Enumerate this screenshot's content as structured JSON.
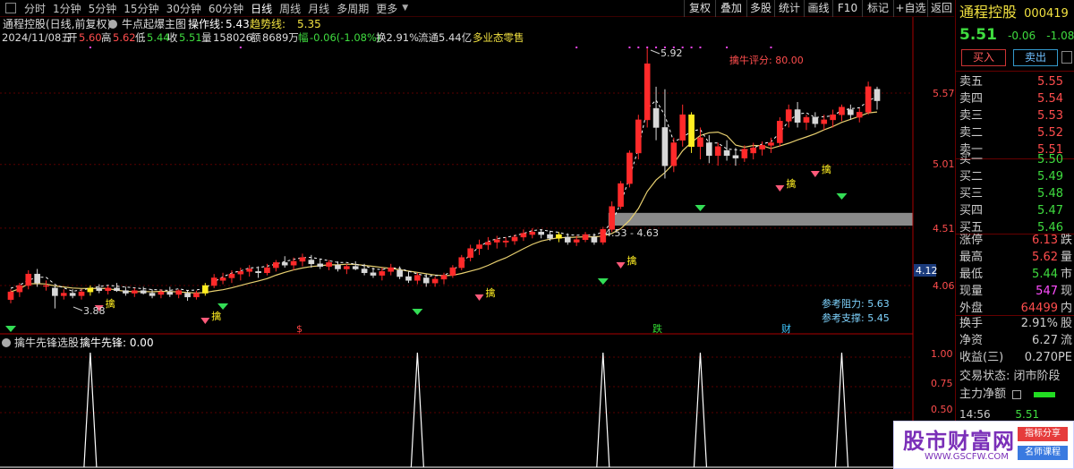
{
  "toolbar": {
    "periods": [
      "分时",
      "1分钟",
      "5分钟",
      "15分钟",
      "30分钟",
      "60分钟",
      "日线",
      "周线",
      "月线",
      "多周期",
      "更多"
    ],
    "active": "日线",
    "tools": [
      "复权",
      "叠加",
      "多股",
      "统计",
      "画线",
      "F10",
      "标记",
      "+自选",
      "返回"
    ]
  },
  "header": {
    "line1": {
      "title": "通程控股(日线,前复权)",
      "ind_name": "牛点起爆主图",
      "op_label": "操作线:",
      "op_value": "5.43",
      "trend_label": "趋势线:",
      "trend_value": "5.35"
    },
    "line2": {
      "date": "2024/11/08五",
      "open_l": "开",
      "open_v": "5.60",
      "high_l": "高",
      "high_v": "5.62",
      "low_l": "低",
      "low_v": "5.44",
      "close_l": "收",
      "close_v": "5.51",
      "vol_l": "量",
      "vol_v": "158026",
      "amt_l": "额",
      "amt_v": "8689万",
      "chg_l": "幅",
      "chg_v": "-0.06(-1.08%)",
      "turn": "换2.91%",
      "float": "流通5.44亿",
      "status": "多业态零售"
    }
  },
  "annotations": {
    "peak": "5.92",
    "low": "3.88",
    "rating": "擒牛评分: 80.00",
    "range": "4.53 - 4.63",
    "resist": "参考阻力: 5.63",
    "support": "参考支撑: 5.45",
    "marks": [
      {
        "t": "$",
        "c": "#ff4444"
      },
      {
        "t": "跌",
        "c": "#33dd33"
      },
      {
        "t": "财",
        "c": "#3fc7ff"
      }
    ],
    "signal_char": "擒"
  },
  "axis": {
    "price_ticks": [
      "5.57",
      "5.01",
      "4.51",
      "4.06"
    ],
    "current_price": "4.12",
    "ind_ticks": [
      "1.00",
      "0.75",
      "0.50"
    ]
  },
  "indicator": {
    "name": "擒牛先锋选股",
    "label": "擒牛先锋: 0.00"
  },
  "quote": {
    "name": "通程控股",
    "code": "000419",
    "price": "5.51",
    "change": "-0.06",
    "pct": "-1.08%",
    "buy": "买入",
    "sell": "卖出",
    "asks": [
      {
        "l": "卖五",
        "p": "5.55"
      },
      {
        "l": "卖四",
        "p": "5.54"
      },
      {
        "l": "卖三",
        "p": "5.53"
      },
      {
        "l": "卖二",
        "p": "5.52"
      },
      {
        "l": "卖一",
        "p": "5.51"
      }
    ],
    "bids": [
      {
        "l": "买一",
        "p": "5.50"
      },
      {
        "l": "买二",
        "p": "5.49"
      },
      {
        "l": "买三",
        "p": "5.48"
      },
      {
        "l": "买四",
        "p": "5.47"
      },
      {
        "l": "买五",
        "p": "5.46"
      }
    ],
    "stats": [
      {
        "l": "涨停",
        "v": "6.13",
        "s": "跌",
        "c": "red"
      },
      {
        "l": "最高",
        "v": "5.62",
        "s": "量",
        "c": "red"
      },
      {
        "l": "最低",
        "v": "5.44",
        "s": "市",
        "c": "grn"
      },
      {
        "l": "现量",
        "v": "547",
        "s": "现",
        "c": "mag"
      },
      {
        "l": "外盘",
        "v": "64499",
        "s": "内",
        "c": "red"
      }
    ],
    "stats2": [
      {
        "l": "换手",
        "v": "2.91%",
        "s": "股"
      },
      {
        "l": "净资",
        "v": "6.27",
        "s": "流"
      },
      {
        "l": "收益(三)",
        "v": "0.270",
        "s": "PE"
      }
    ],
    "trade_status": "交易状态: 闭市阶段",
    "main_flow": "主力净额",
    "time": "14:56",
    "last": "5.51"
  },
  "watermark": {
    "site": "股市财富网",
    "url": "WWW.GSCFW.COM",
    "tag1": "指标分享",
    "tag2": "名师课程"
  },
  "chart_data": {
    "type": "candlestick",
    "candles": [
      [
        3.95,
        4.03,
        3.92,
        4.01
      ],
      [
        4.01,
        4.08,
        3.97,
        4.06
      ],
      [
        4.06,
        4.18,
        4.03,
        4.15
      ],
      [
        4.15,
        4.19,
        4.05,
        4.08
      ],
      [
        4.06,
        4.1,
        4.02,
        4.06
      ],
      [
        4.04,
        4.06,
        3.88,
        3.98
      ],
      [
        3.98,
        4.03,
        3.95,
        4.0
      ],
      [
        4.0,
        4.03,
        3.96,
        3.98
      ],
      [
        3.98,
        4.03,
        3.95,
        4.01
      ],
      [
        4.01,
        4.06,
        3.98,
        4.04
      ],
      [
        4.04,
        4.07,
        4.0,
        4.02
      ],
      [
        4.02,
        4.06,
        3.99,
        4.04
      ],
      [
        4.04,
        4.08,
        4.01,
        4.02
      ],
      [
        4.02,
        4.05,
        3.98,
        4.0
      ],
      [
        4.0,
        4.04,
        3.97,
        4.02
      ],
      [
        4.02,
        4.05,
        3.99,
        4.0
      ],
      [
        4.0,
        4.03,
        3.96,
        3.98
      ],
      [
        3.99,
        4.03,
        3.96,
        4.01
      ],
      [
        4.01,
        4.05,
        3.97,
        3.99
      ],
      [
        3.99,
        4.03,
        3.96,
        4.02
      ],
      [
        4.0,
        4.02,
        3.94,
        3.97
      ],
      [
        3.97,
        4.02,
        3.95,
        4.0
      ],
      [
        4.0,
        4.08,
        3.98,
        4.06
      ],
      [
        4.06,
        4.15,
        4.04,
        4.12
      ],
      [
        4.1,
        4.16,
        4.07,
        4.12
      ],
      [
        4.12,
        4.18,
        4.08,
        4.15
      ],
      [
        4.15,
        4.2,
        4.1,
        4.17
      ],
      [
        4.17,
        4.22,
        4.13,
        4.19
      ],
      [
        4.17,
        4.21,
        4.12,
        4.16
      ],
      [
        4.16,
        4.23,
        4.14,
        4.2
      ],
      [
        4.2,
        4.26,
        4.17,
        4.24
      ],
      [
        4.24,
        4.29,
        4.2,
        4.22
      ],
      [
        4.22,
        4.28,
        4.18,
        4.25
      ],
      [
        4.25,
        4.31,
        4.21,
        4.28
      ],
      [
        4.26,
        4.3,
        4.2,
        4.23
      ],
      [
        4.23,
        4.27,
        4.19,
        4.21
      ],
      [
        4.21,
        4.26,
        4.18,
        4.24
      ],
      [
        4.22,
        4.25,
        4.17,
        4.19
      ],
      [
        4.19,
        4.23,
        4.15,
        4.21
      ],
      [
        4.21,
        4.25,
        4.18,
        4.19
      ],
      [
        4.19,
        4.23,
        4.14,
        4.16
      ],
      [
        4.16,
        4.2,
        4.12,
        4.14
      ],
      [
        4.14,
        4.2,
        4.1,
        4.17
      ],
      [
        4.17,
        4.23,
        4.14,
        4.2
      ],
      [
        4.18,
        4.21,
        4.11,
        4.13
      ],
      [
        4.13,
        4.17,
        4.08,
        4.1
      ],
      [
        4.1,
        4.16,
        4.07,
        4.14
      ],
      [
        4.12,
        4.15,
        4.05,
        4.08
      ],
      [
        4.08,
        4.13,
        4.05,
        4.11
      ],
      [
        4.11,
        4.16,
        4.07,
        4.14
      ],
      [
        4.14,
        4.22,
        4.12,
        4.2
      ],
      [
        4.2,
        4.3,
        4.18,
        4.28
      ],
      [
        4.28,
        4.38,
        4.25,
        4.35
      ],
      [
        4.35,
        4.42,
        4.3,
        4.38
      ],
      [
        4.38,
        4.44,
        4.34,
        4.4
      ],
      [
        4.4,
        4.45,
        4.35,
        4.42
      ],
      [
        4.4,
        4.44,
        4.36,
        4.41
      ],
      [
        4.41,
        4.46,
        4.38,
        4.44
      ],
      [
        4.44,
        4.5,
        4.41,
        4.47
      ],
      [
        4.46,
        4.51,
        4.43,
        4.48
      ],
      [
        4.48,
        4.5,
        4.43,
        4.46
      ],
      [
        4.46,
        4.49,
        4.41,
        4.43
      ],
      [
        4.43,
        4.48,
        4.4,
        4.46
      ],
      [
        4.44,
        4.47,
        4.38,
        4.4
      ],
      [
        4.4,
        4.45,
        4.37,
        4.42
      ],
      [
        4.42,
        4.48,
        4.4,
        4.46
      ],
      [
        4.44,
        4.47,
        4.38,
        4.4
      ],
      [
        4.4,
        4.52,
        4.38,
        4.5
      ],
      [
        4.5,
        4.72,
        4.48,
        4.68
      ],
      [
        4.68,
        4.88,
        4.66,
        4.86
      ],
      [
        4.86,
        5.12,
        4.83,
        5.1
      ],
      [
        5.1,
        5.4,
        5.05,
        5.36
      ],
      [
        5.36,
        5.92,
        5.3,
        5.8
      ],
      [
        5.45,
        5.62,
        5.2,
        5.3
      ],
      [
        5.3,
        5.6,
        4.9,
        5.0
      ],
      [
        5.0,
        5.22,
        4.95,
        5.18
      ],
      [
        5.2,
        5.48,
        5.15,
        5.4
      ],
      [
        5.4,
        5.42,
        5.1,
        5.15
      ],
      [
        5.15,
        5.3,
        5.05,
        5.22
      ],
      [
        5.18,
        5.24,
        5.02,
        5.08
      ],
      [
        5.08,
        5.18,
        5.0,
        5.15
      ],
      [
        5.12,
        5.2,
        5.04,
        5.08
      ],
      [
        5.08,
        5.14,
        5.0,
        5.06
      ],
      [
        5.06,
        5.16,
        5.03,
        5.13
      ],
      [
        5.1,
        5.18,
        5.05,
        5.14
      ],
      [
        5.13,
        5.19,
        5.08,
        5.16
      ],
      [
        5.16,
        5.22,
        5.1,
        5.18
      ],
      [
        5.18,
        5.38,
        5.15,
        5.35
      ],
      [
        5.35,
        5.48,
        5.3,
        5.44
      ],
      [
        5.44,
        5.5,
        5.3,
        5.34
      ],
      [
        5.34,
        5.4,
        5.28,
        5.38
      ],
      [
        5.38,
        5.42,
        5.3,
        5.33
      ],
      [
        5.33,
        5.4,
        5.28,
        5.36
      ],
      [
        5.36,
        5.44,
        5.3,
        5.4
      ],
      [
        5.4,
        5.48,
        5.35,
        5.46
      ],
      [
        5.44,
        5.48,
        5.36,
        5.4
      ],
      [
        5.38,
        5.45,
        5.34,
        5.42
      ],
      [
        5.42,
        5.66,
        5.4,
        5.62
      ],
      [
        5.6,
        5.62,
        5.44,
        5.51
      ]
    ],
    "indicator_spikes": [
      9,
      46,
      67,
      78,
      94
    ],
    "ylim": [
      3.8,
      6.0
    ]
  }
}
